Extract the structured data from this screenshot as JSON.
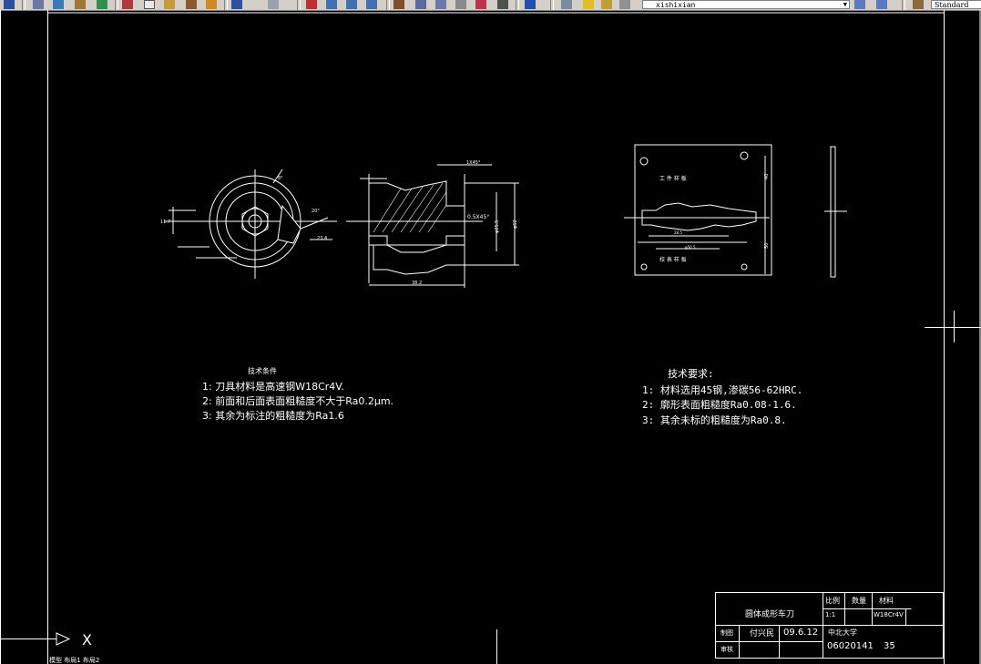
{
  "toolbar": {
    "layer_name": "xishixian",
    "text_style": "Standard"
  },
  "colors": {
    "background": "#000000",
    "lines": "#ffffff",
    "toolbar": "#d4d0c8"
  },
  "drawing": {
    "tech_left": {
      "title": "技术条件",
      "lines": [
        "1: 刀具材料是高速钢W18Cr4V.",
        "2: 前面和后面表面粗糙度不大于Ra0.2μm.",
        "3: 其余为标注的粗糙度为Ra1.6"
      ]
    },
    "tech_right": {
      "title": "技术要求:",
      "lines": [
        "1: 材料选用45钢,渗碳56-62HRC.",
        "2: 廓形表面粗糙度Ra0.08-1.6.",
        "3: 其余未标的粗糙度为Ra0.8."
      ]
    },
    "dims": {
      "d1": "1X45°",
      "d2": "0.5X45°",
      "d3": "38.2",
      "d4": "23.4",
      "d5": "φ62",
      "d6": "φ25.5",
      "d7": "φ50.5",
      "d8": "28.5",
      "d9": "11.7",
      "d10": "40",
      "d11": "50",
      "d12": "20°",
      "d13": "8°"
    },
    "plate_labels": {
      "top": "工 件 样 板",
      "bottom": "校 表 样 板"
    }
  },
  "title_block": {
    "name": "圆体成形车刀",
    "scale_label": "比例",
    "qty_label": "数量",
    "material_label": "材料",
    "scale_value": "1:1",
    "material_value": "W18Cr4V",
    "drawn_label": "制图",
    "drawn_by": "付兴民",
    "date": "09.6.12",
    "review_label": "审核",
    "school": "中北大学",
    "number": "06020141",
    "sub": "35"
  },
  "ucs": {
    "x_label": "X"
  },
  "tabs": "模型 布局1 布局2"
}
